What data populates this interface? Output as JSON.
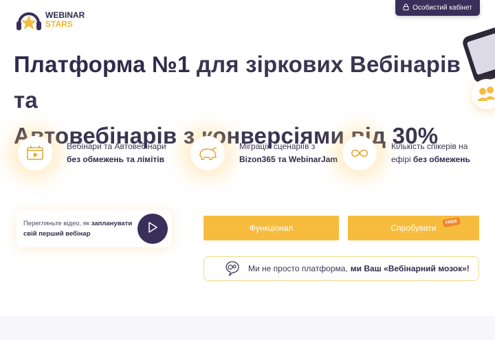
{
  "logo": {
    "line1": "WEBINAR",
    "line2": "STARS",
    "icon": "headphones-star-icon"
  },
  "header": {
    "cabinet_label": "Особистий кабінет",
    "cabinet_icon": "lock-icon"
  },
  "hero": {
    "title_bold": "Платформа №1",
    "title_rest_1": " для зіркових Вебінарів та",
    "title_line_2": "Автовебінарів з конверсіями від 30%"
  },
  "features": [
    {
      "icon": "video-calendar-icon",
      "line1": "Вебінари та Автовебінари",
      "line2_bold": "без обмежень та лімітів"
    },
    {
      "icon": "bison-icon",
      "line1": "Міграція сценаріїв з",
      "line2_bold": "Bizon365 та WebinarJam"
    },
    {
      "icon": "infinity-icon",
      "line1": "Кількість спікерів на",
      "line2_plain": "ефірі ",
      "line2_bold": "без обмежень"
    }
  ],
  "video_card": {
    "text_plain": "Перегляньте відео, як ",
    "text_bold_1": "запланувати",
    "text_bold_2": "свій перший вебінар",
    "play_icon": "play-icon"
  },
  "buttons": {
    "functional": "Функціонал",
    "try": "Спробувати",
    "free_badge": "FREE"
  },
  "brain": {
    "icon": "brain-gears-icon",
    "text_plain": "Ми не просто платформа, ",
    "text_bold": "ми Ваш «Вебінарний мозок»!"
  },
  "colors": {
    "accent_yellow": "#f7bc3d",
    "dark_purple": "#3a2f5a",
    "badge_orange": "#f0842c"
  }
}
